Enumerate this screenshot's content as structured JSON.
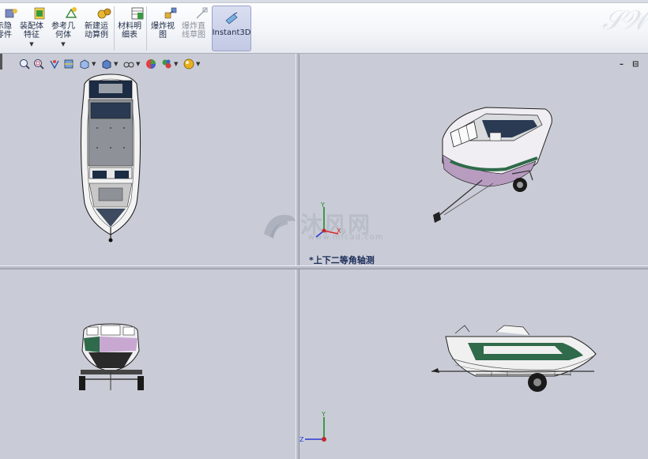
{
  "ribbon": {
    "buttons": [
      {
        "label": "示隐\n零件",
        "icon": "show-hidden-components-icon"
      },
      {
        "label": "装配体\n特征",
        "icon": "assembly-features-icon"
      },
      {
        "label": "参考几\n何体",
        "icon": "reference-geometry-icon"
      },
      {
        "label": "新建运\n动算例",
        "icon": "new-motion-study-icon"
      },
      {
        "label": "材料明\n细表",
        "icon": "bill-of-materials-icon"
      },
      {
        "label": "爆炸视\n图",
        "icon": "exploded-view-icon"
      },
      {
        "label": "爆炸直\n线草图",
        "icon": "explode-line-sketch-icon"
      }
    ],
    "instant3d_label": "Instant3D"
  },
  "view_toolbar": {
    "icons": [
      "zoom-to-fit-icon",
      "zoom-to-area-icon",
      "previous-view-icon",
      "section-view-icon",
      "view-orientation-icon",
      "display-style-icon",
      "hide-show-items-icon",
      "edit-appearance-icon",
      "apply-scene-icon",
      "view-settings-icon"
    ]
  },
  "window_controls": {
    "minimize": "–",
    "restore": "⊟"
  },
  "viewports": {
    "top_right_label": "*上下二等角轴测"
  },
  "watermark": {
    "main": "沐风网",
    "sub": "www.mfcad.com"
  },
  "colors": {
    "viewport_bg": "#c9ccd6",
    "hull_green": "#2f6a4a",
    "hull_white": "#f2f2f2",
    "axis_x": "#d42a2a",
    "axis_y": "#1e8a2a",
    "axis_z": "#2a3ad4"
  }
}
